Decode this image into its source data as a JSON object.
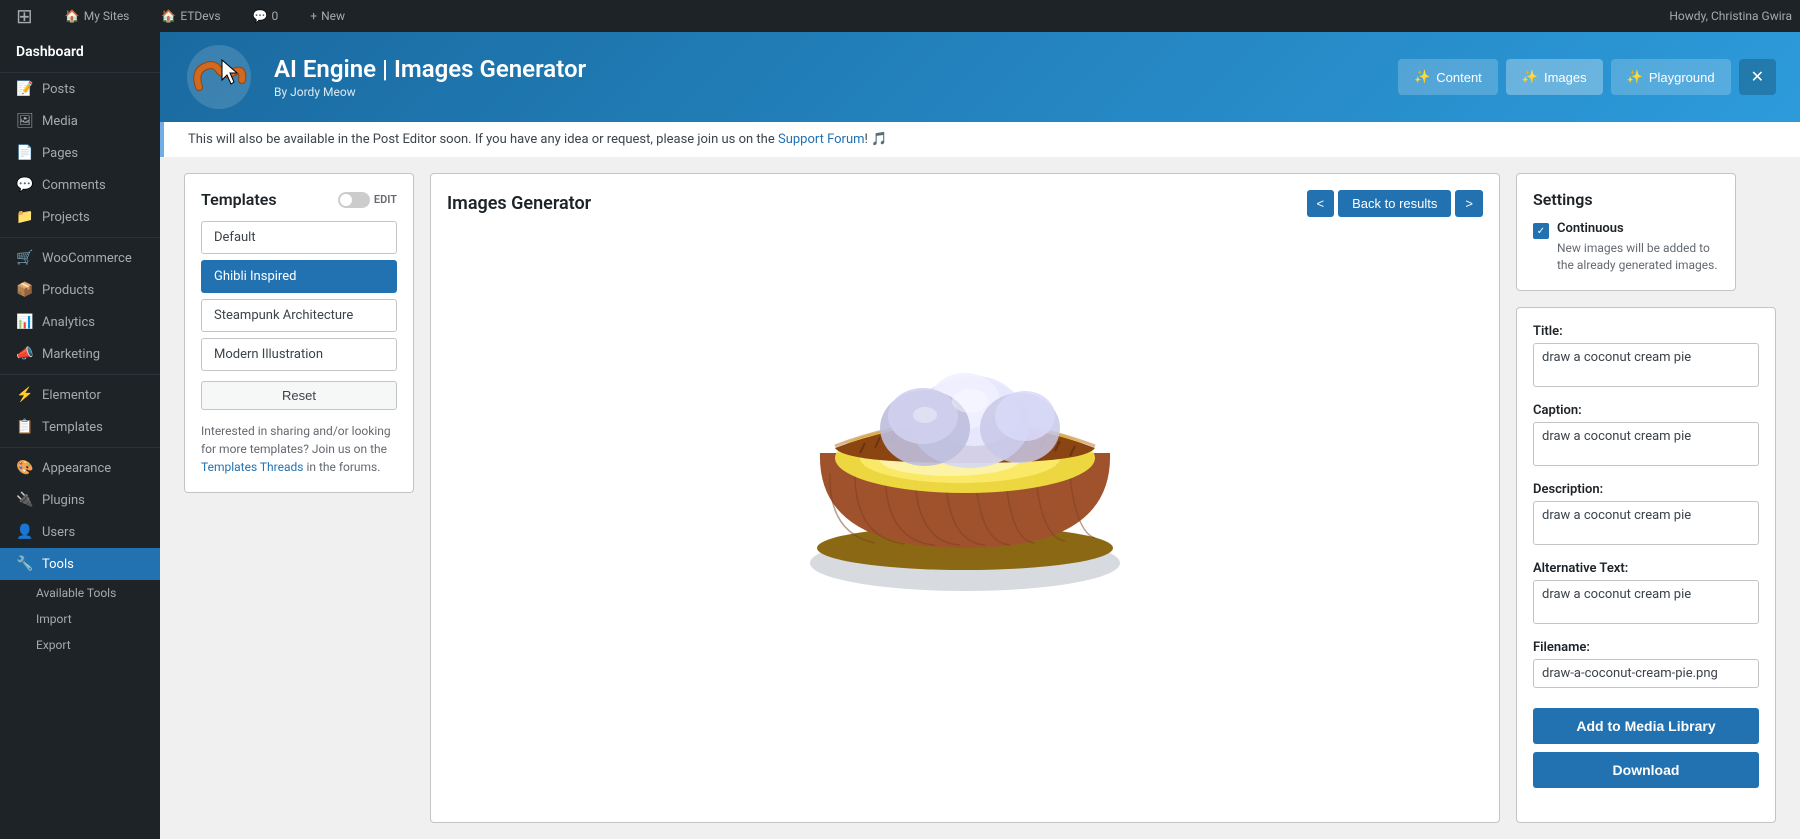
{
  "adminBar": {
    "logo": "⊞",
    "items": [
      {
        "id": "my-sites",
        "icon": "🏠",
        "label": "My Sites"
      },
      {
        "id": "et-devs",
        "icon": "🏠",
        "label": "ETDevs"
      },
      {
        "id": "comments",
        "icon": "💬",
        "badge": "0"
      },
      {
        "id": "new",
        "icon": "+",
        "label": "New"
      }
    ],
    "userGreeting": "Howdy, Christina Gwira"
  },
  "sidebar": {
    "brand": "Dashboard",
    "items": [
      {
        "id": "posts",
        "icon": "📝",
        "label": "Posts"
      },
      {
        "id": "media",
        "icon": "🖼",
        "label": "Media"
      },
      {
        "id": "pages",
        "icon": "📄",
        "label": "Pages"
      },
      {
        "id": "comments",
        "icon": "💬",
        "label": "Comments"
      },
      {
        "id": "projects",
        "icon": "📁",
        "label": "Projects"
      },
      {
        "id": "woocommerce",
        "icon": "🛒",
        "label": "WooCommerce"
      },
      {
        "id": "products",
        "icon": "📦",
        "label": "Products"
      },
      {
        "id": "analytics",
        "icon": "📊",
        "label": "Analytics"
      },
      {
        "id": "marketing",
        "icon": "📣",
        "label": "Marketing"
      },
      {
        "id": "elementor",
        "icon": "⚡",
        "label": "Elementor"
      },
      {
        "id": "templates",
        "icon": "📋",
        "label": "Templates"
      },
      {
        "id": "appearance",
        "icon": "🎨",
        "label": "Appearance"
      },
      {
        "id": "plugins",
        "icon": "🔌",
        "label": "Plugins"
      },
      {
        "id": "users",
        "icon": "👤",
        "label": "Users"
      },
      {
        "id": "tools",
        "icon": "🔧",
        "label": "Tools",
        "active": true
      }
    ],
    "subItems": [
      {
        "id": "available-tools",
        "label": "Available Tools"
      },
      {
        "id": "import",
        "label": "Import"
      },
      {
        "id": "export",
        "label": "Export"
      }
    ]
  },
  "pluginHeader": {
    "title": "AI Engine | Images Generator",
    "subtitle": "By Jordy Meow",
    "navButtons": [
      {
        "id": "content",
        "icon": "✨",
        "label": "Content"
      },
      {
        "id": "images",
        "icon": "✨",
        "label": "Images",
        "active": true
      },
      {
        "id": "playground",
        "icon": "✨",
        "label": "Playground"
      }
    ],
    "closeIcon": "✕"
  },
  "notice": {
    "text": "This will also be available in the Post Editor soon. If you have any idea or request, please join us on the",
    "linkText": "Support Forum",
    "suffix": "! 🎵"
  },
  "templates": {
    "title": "Templates",
    "editLabel": "EDIT",
    "items": [
      {
        "id": "default",
        "label": "Default",
        "selected": false
      },
      {
        "id": "ghibli-inspired",
        "label": "Ghibli Inspired",
        "selected": true
      },
      {
        "id": "steampunk-architecture",
        "label": "Steampunk Architecture",
        "selected": false
      },
      {
        "id": "modern-illustration",
        "label": "Modern Illustration",
        "selected": false
      }
    ],
    "resetLabel": "Reset",
    "footerText": "Interested in sharing and/or looking for more templates? Join us on the",
    "footerLinkText": "Templates Threads",
    "footerSuffix": "in the forums."
  },
  "generator": {
    "title": "Images Generator",
    "navPrev": "<",
    "navNext": ">",
    "backToResults": "Back to results"
  },
  "form": {
    "fields": [
      {
        "id": "title",
        "label": "Title:",
        "value": "draw a coconut cream pie",
        "type": "textarea"
      },
      {
        "id": "caption",
        "label": "Caption:",
        "value": "draw a coconut cream pie",
        "type": "textarea"
      },
      {
        "id": "description",
        "label": "Description:",
        "value": "draw a coconut cream pie",
        "type": "textarea"
      },
      {
        "id": "alternative-text",
        "label": "Alternative Text:",
        "value": "draw a coconut cream pie",
        "type": "textarea"
      },
      {
        "id": "filename",
        "label": "Filename:",
        "value": "draw-a-coconut-cream-pie.png",
        "type": "input"
      }
    ],
    "addToMediaLabel": "Add to Media Library",
    "downloadLabel": "Download"
  },
  "settings": {
    "title": "Settings",
    "continuous": {
      "label": "Continuous",
      "description": "New images will be added to the already generated images.",
      "checked": true
    }
  },
  "colors": {
    "primary": "#2271b1",
    "headerBg": "#2d9bdb",
    "sidebarBg": "#1d2327",
    "activeItem": "#2271b1"
  }
}
